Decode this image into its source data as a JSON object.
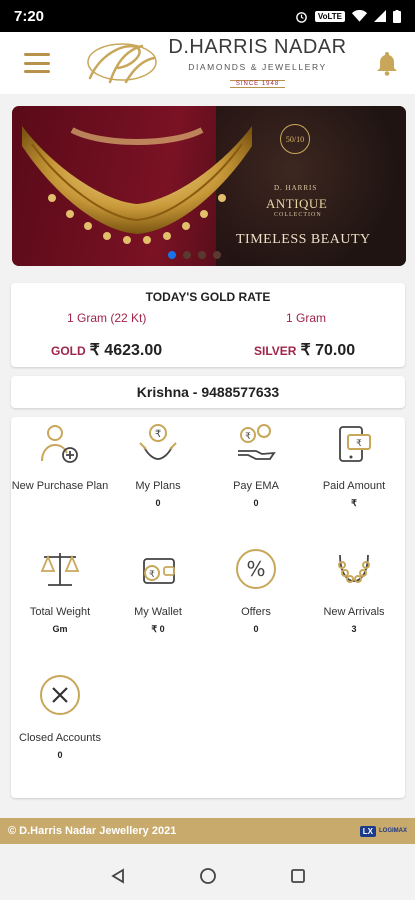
{
  "status": {
    "time": "7:20",
    "network": "VoLTE"
  },
  "header": {
    "brand_name": "D.HARRIS NADAR",
    "brand_tagline": "DIAMONDS & JEWELLERY",
    "brand_since": "SINCE 1948"
  },
  "banner": {
    "seal": "50/10",
    "brand_line": "D. HARRIS",
    "collection_title": "ANTIQUE",
    "collection_word": "COLLECTION",
    "tagline": "TIMELESS BEAUTY",
    "slides": 4,
    "active_slide": 0
  },
  "rates": {
    "title": "TODAY'S GOLD RATE",
    "gold_unit": "1 Gram (22 Kt)",
    "silver_unit": "1 Gram",
    "gold_label": "GOLD",
    "gold_value": "₹ 4623.00",
    "silver_label": "SILVER",
    "silver_value": "₹ 70.00"
  },
  "member": {
    "text": "Krishna - 9488577633"
  },
  "tiles": [
    {
      "label": "New Purchase Plan",
      "value": "",
      "icon": "new-purchase-plan-icon"
    },
    {
      "label": "My Plans",
      "value": "0",
      "icon": "my-plans-icon"
    },
    {
      "label": "Pay EMA",
      "value": "0",
      "icon": "pay-ema-icon"
    },
    {
      "label": "Paid Amount",
      "value": "₹",
      "icon": "paid-amount-icon"
    },
    {
      "label": "Total Weight",
      "value": "Gm",
      "icon": "scale-icon"
    },
    {
      "label": "My Wallet",
      "value": "₹ 0",
      "icon": "wallet-icon"
    },
    {
      "label": "Offers",
      "value": "0",
      "icon": "percent-icon"
    },
    {
      "label": "New Arrivals",
      "value": "3",
      "icon": "necklace-icon"
    },
    {
      "label": "Closed Accounts",
      "value": "0",
      "icon": "close-circle-icon"
    }
  ],
  "footer": {
    "copyright": "© D.Harris Nadar Jewellery 2021",
    "partner": "LOGIMAX",
    "partner_badge": "LX"
  },
  "colors": {
    "gold": "#b8924a",
    "maroon": "#a0254a",
    "footer": "#c8aa6c"
  }
}
